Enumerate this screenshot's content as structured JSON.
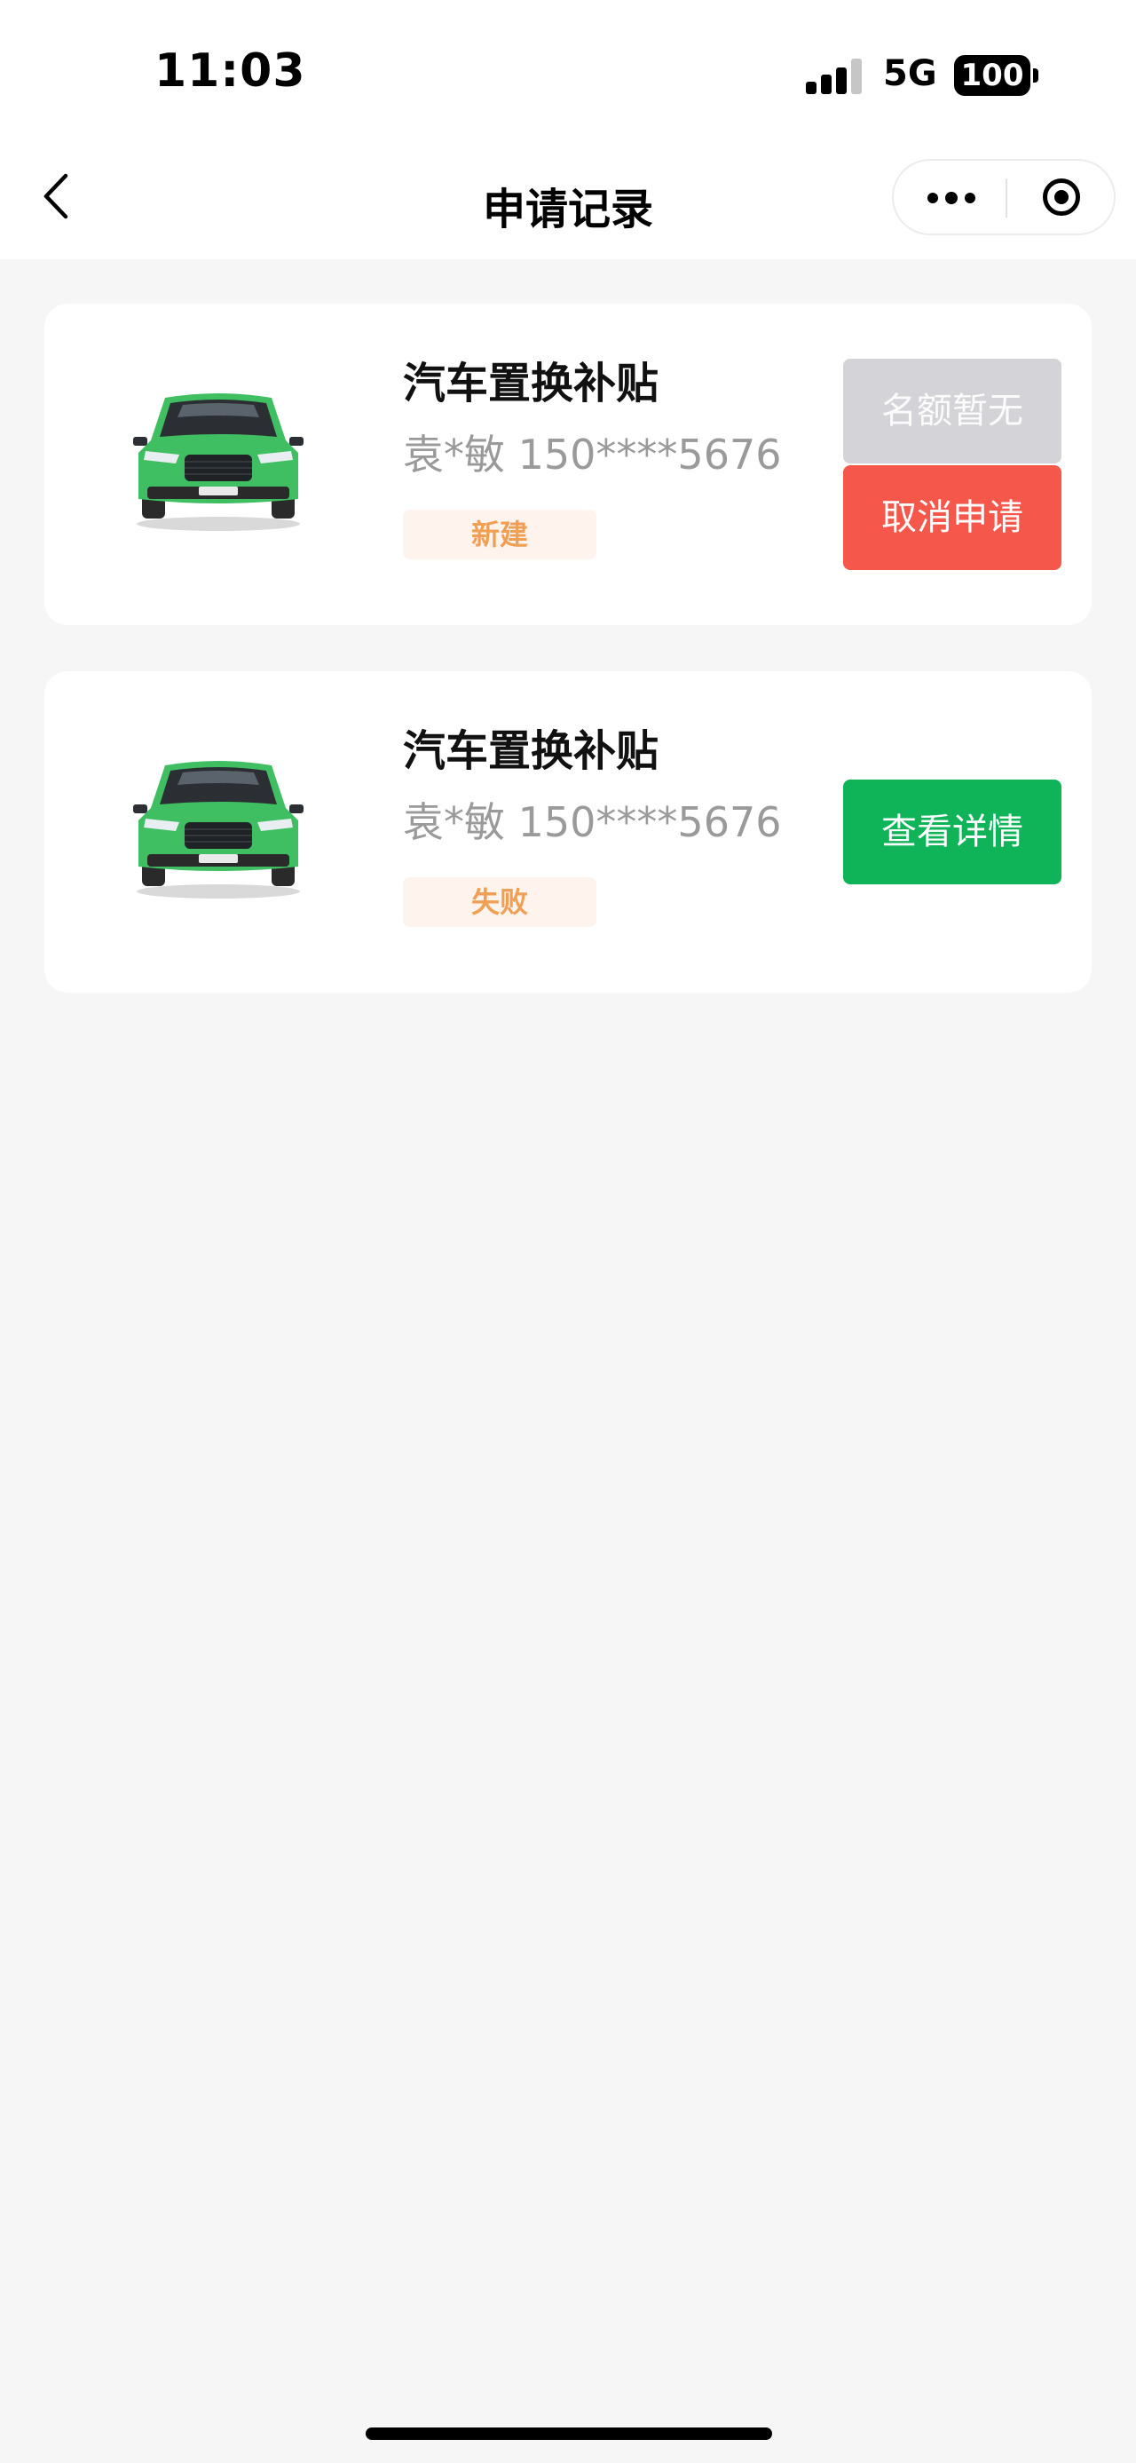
{
  "status_bar": {
    "time": "11:03",
    "network": "5G",
    "battery": "100"
  },
  "nav": {
    "title": "申请记录"
  },
  "records": [
    {
      "title": "汽车置换补贴",
      "applicant": "袁*敏 150****5676",
      "status": "新建",
      "buttons": {
        "quota": "名额暂无",
        "cancel": "取消申请"
      }
    },
    {
      "title": "汽车置换补贴",
      "applicant": "袁*敏 150****5676",
      "status": "失败",
      "buttons": {
        "details": "查看详情"
      }
    }
  ],
  "colors": {
    "accent_green": "#0fb358",
    "cancel_red": "#f5584b",
    "disabled_grey": "#d3d3d8",
    "status_tag_text": "#f0a055",
    "car_body": "#3fbf62"
  },
  "icons": [
    "back-arrow-icon",
    "more-dots-icon",
    "close-target-icon",
    "car-image"
  ]
}
